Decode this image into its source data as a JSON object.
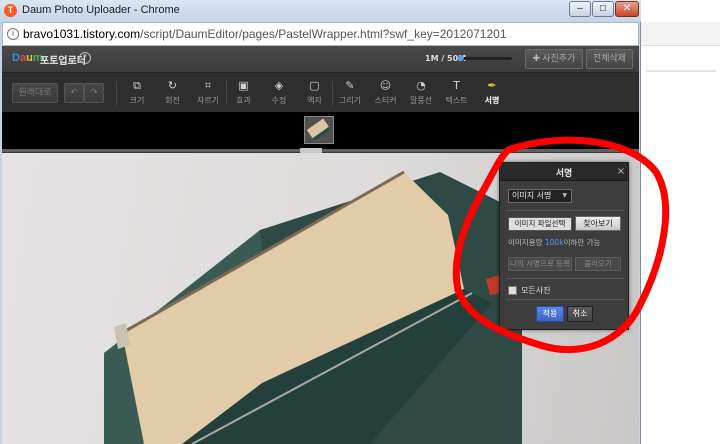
{
  "window": {
    "title": "Daum Photo Uploader - Chrome",
    "url_host": "bravo1031.tistory.com",
    "url_path": "/script/DaumEditor/pages/PastelWrapper.html?swf_key=2012071201",
    "minimize": "–",
    "maximize": "□",
    "close": "✕"
  },
  "app": {
    "logo": [
      "D",
      "a",
      "u",
      "m"
    ],
    "name": "포토업로더",
    "help": "?",
    "capacity": "1M / 50M",
    "capacity_fraction": 0.02,
    "add_photo": "사진추가",
    "delete_all": "전체삭제"
  },
  "toolbar": {
    "original": "원래대로",
    "undo": "↶",
    "redo": "↷",
    "tools": [
      {
        "label": "크기",
        "icon": "resize-icon"
      },
      {
        "label": "회전",
        "icon": "rotate-icon"
      },
      {
        "label": "자르기",
        "icon": "crop-icon"
      },
      {
        "label": "효과",
        "icon": "effect-icon"
      },
      {
        "label": "수정",
        "icon": "eraser-icon"
      },
      {
        "label": "액자",
        "icon": "frame-icon"
      },
      {
        "label": "그리기",
        "icon": "brush-icon"
      },
      {
        "label": "스티커",
        "icon": "sticker-icon"
      },
      {
        "label": "말풍선",
        "icon": "speech-bubble-icon"
      },
      {
        "label": "텍스트",
        "icon": "text-icon"
      },
      {
        "label": "서명",
        "icon": "pen-icon",
        "active": true
      }
    ]
  },
  "dialog": {
    "title": "서명",
    "close": "×",
    "select_value": "이미지 서명",
    "file_select": "이미지 파일선택",
    "browse": "찾아보기",
    "size_note_prefix": "이미지용량 ",
    "size_note_highlight": "100k",
    "size_note_suffix": "이하만 가능",
    "register": "나의 서명으로 등록",
    "load": "불러오기",
    "all_photos": "모든사진",
    "apply": "적용",
    "cancel": "취소"
  },
  "colors": {
    "annotation": "#ff0000",
    "accent": "#4d86d8"
  }
}
